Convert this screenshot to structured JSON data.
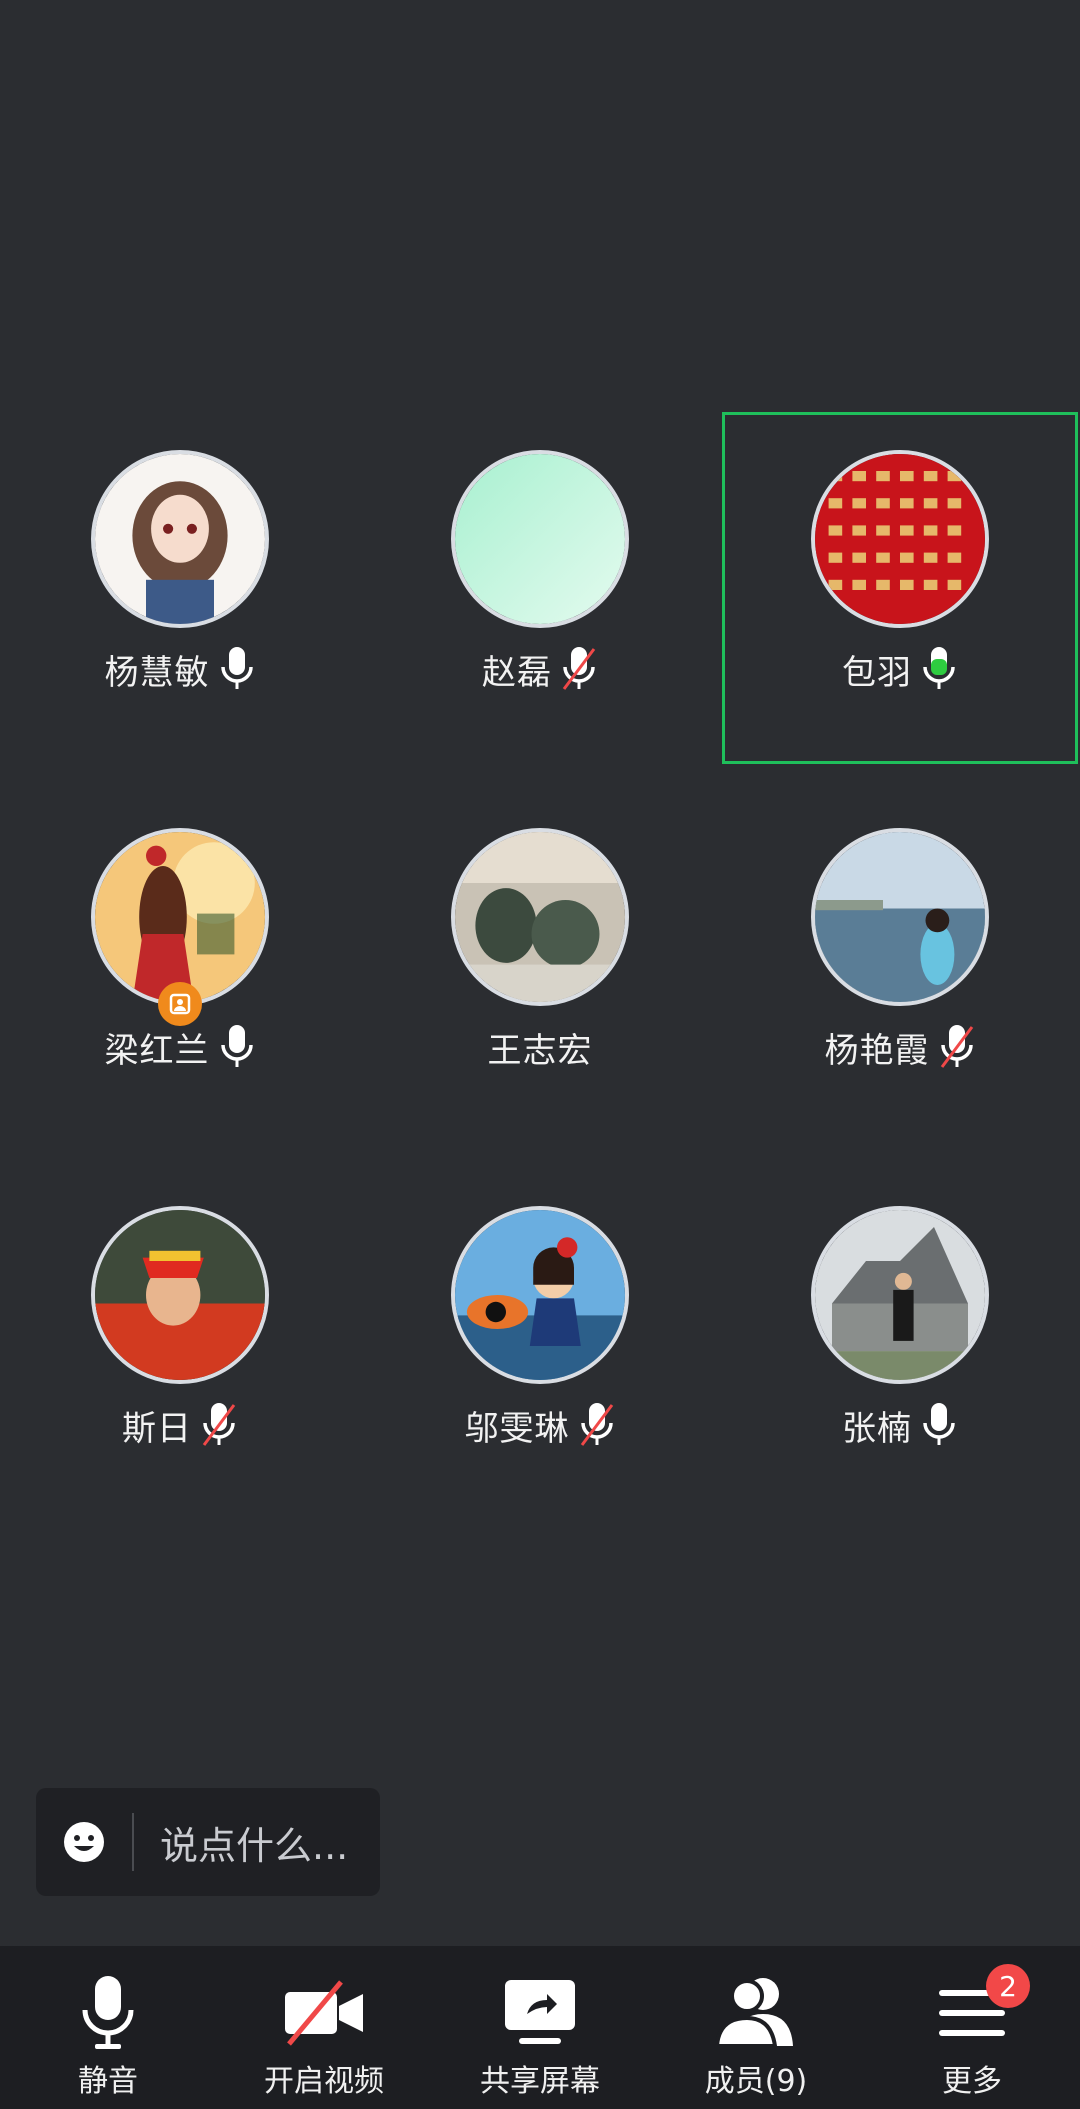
{
  "participants": [
    {
      "name": "杨慧敏",
      "mic": "on"
    },
    {
      "name": "赵磊",
      "mic": "muted"
    },
    {
      "name": "包羽",
      "mic": "speaking",
      "active_speaker": true
    },
    {
      "name": "梁红兰",
      "mic": "on",
      "host_badge": true
    },
    {
      "name": "王志宏",
      "mic": "none"
    },
    {
      "name": "杨艳霞",
      "mic": "muted"
    },
    {
      "name": "斯日",
      "mic": "muted"
    },
    {
      "name": "邬雯琳",
      "mic": "muted"
    },
    {
      "name": "张楠",
      "mic": "on"
    }
  ],
  "chat": {
    "placeholder": "说点什么..."
  },
  "toolbar": {
    "mute_label": "静音",
    "video_label": "开启视频",
    "share_label": "共享屏幕",
    "members_label": "成员(9)",
    "more_label": "更多",
    "more_badge": "2"
  },
  "colors": {
    "background": "#2b2d31",
    "active_border": "#1fbf5b",
    "speaking_mic": "#2ecc40",
    "muted_slash": "#f04848",
    "badge": "#f24848"
  }
}
